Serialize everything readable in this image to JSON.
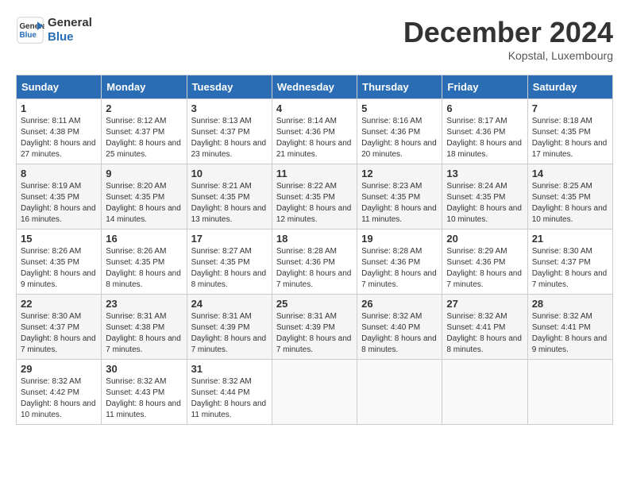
{
  "header": {
    "logo_line1": "General",
    "logo_line2": "Blue",
    "month_title": "December 2024",
    "location": "Kopstal, Luxembourg"
  },
  "days_of_week": [
    "Sunday",
    "Monday",
    "Tuesday",
    "Wednesday",
    "Thursday",
    "Friday",
    "Saturday"
  ],
  "weeks": [
    [
      {
        "day": "1",
        "sunrise": "8:11 AM",
        "sunset": "4:38 PM",
        "daylight": "8 hours and 27 minutes"
      },
      {
        "day": "2",
        "sunrise": "8:12 AM",
        "sunset": "4:37 PM",
        "daylight": "8 hours and 25 minutes"
      },
      {
        "day": "3",
        "sunrise": "8:13 AM",
        "sunset": "4:37 PM",
        "daylight": "8 hours and 23 minutes"
      },
      {
        "day": "4",
        "sunrise": "8:14 AM",
        "sunset": "4:36 PM",
        "daylight": "8 hours and 21 minutes"
      },
      {
        "day": "5",
        "sunrise": "8:16 AM",
        "sunset": "4:36 PM",
        "daylight": "8 hours and 20 minutes"
      },
      {
        "day": "6",
        "sunrise": "8:17 AM",
        "sunset": "4:36 PM",
        "daylight": "8 hours and 18 minutes"
      },
      {
        "day": "7",
        "sunrise": "8:18 AM",
        "sunset": "4:35 PM",
        "daylight": "8 hours and 17 minutes"
      }
    ],
    [
      {
        "day": "8",
        "sunrise": "8:19 AM",
        "sunset": "4:35 PM",
        "daylight": "8 hours and 16 minutes"
      },
      {
        "day": "9",
        "sunrise": "8:20 AM",
        "sunset": "4:35 PM",
        "daylight": "8 hours and 14 minutes"
      },
      {
        "day": "10",
        "sunrise": "8:21 AM",
        "sunset": "4:35 PM",
        "daylight": "8 hours and 13 minutes"
      },
      {
        "day": "11",
        "sunrise": "8:22 AM",
        "sunset": "4:35 PM",
        "daylight": "8 hours and 12 minutes"
      },
      {
        "day": "12",
        "sunrise": "8:23 AM",
        "sunset": "4:35 PM",
        "daylight": "8 hours and 11 minutes"
      },
      {
        "day": "13",
        "sunrise": "8:24 AM",
        "sunset": "4:35 PM",
        "daylight": "8 hours and 10 minutes"
      },
      {
        "day": "14",
        "sunrise": "8:25 AM",
        "sunset": "4:35 PM",
        "daylight": "8 hours and 10 minutes"
      }
    ],
    [
      {
        "day": "15",
        "sunrise": "8:26 AM",
        "sunset": "4:35 PM",
        "daylight": "8 hours and 9 minutes"
      },
      {
        "day": "16",
        "sunrise": "8:26 AM",
        "sunset": "4:35 PM",
        "daylight": "8 hours and 8 minutes"
      },
      {
        "day": "17",
        "sunrise": "8:27 AM",
        "sunset": "4:35 PM",
        "daylight": "8 hours and 8 minutes"
      },
      {
        "day": "18",
        "sunrise": "8:28 AM",
        "sunset": "4:36 PM",
        "daylight": "8 hours and 7 minutes"
      },
      {
        "day": "19",
        "sunrise": "8:28 AM",
        "sunset": "4:36 PM",
        "daylight": "8 hours and 7 minutes"
      },
      {
        "day": "20",
        "sunrise": "8:29 AM",
        "sunset": "4:36 PM",
        "daylight": "8 hours and 7 minutes"
      },
      {
        "day": "21",
        "sunrise": "8:30 AM",
        "sunset": "4:37 PM",
        "daylight": "8 hours and 7 minutes"
      }
    ],
    [
      {
        "day": "22",
        "sunrise": "8:30 AM",
        "sunset": "4:37 PM",
        "daylight": "8 hours and 7 minutes"
      },
      {
        "day": "23",
        "sunrise": "8:31 AM",
        "sunset": "4:38 PM",
        "daylight": "8 hours and 7 minutes"
      },
      {
        "day": "24",
        "sunrise": "8:31 AM",
        "sunset": "4:39 PM",
        "daylight": "8 hours and 7 minutes"
      },
      {
        "day": "25",
        "sunrise": "8:31 AM",
        "sunset": "4:39 PM",
        "daylight": "8 hours and 7 minutes"
      },
      {
        "day": "26",
        "sunrise": "8:32 AM",
        "sunset": "4:40 PM",
        "daylight": "8 hours and 8 minutes"
      },
      {
        "day": "27",
        "sunrise": "8:32 AM",
        "sunset": "4:41 PM",
        "daylight": "8 hours and 8 minutes"
      },
      {
        "day": "28",
        "sunrise": "8:32 AM",
        "sunset": "4:41 PM",
        "daylight": "8 hours and 9 minutes"
      }
    ],
    [
      {
        "day": "29",
        "sunrise": "8:32 AM",
        "sunset": "4:42 PM",
        "daylight": "8 hours and 10 minutes"
      },
      {
        "day": "30",
        "sunrise": "8:32 AM",
        "sunset": "4:43 PM",
        "daylight": "8 hours and 11 minutes"
      },
      {
        "day": "31",
        "sunrise": "8:32 AM",
        "sunset": "4:44 PM",
        "daylight": "8 hours and 11 minutes"
      },
      null,
      null,
      null,
      null
    ]
  ]
}
